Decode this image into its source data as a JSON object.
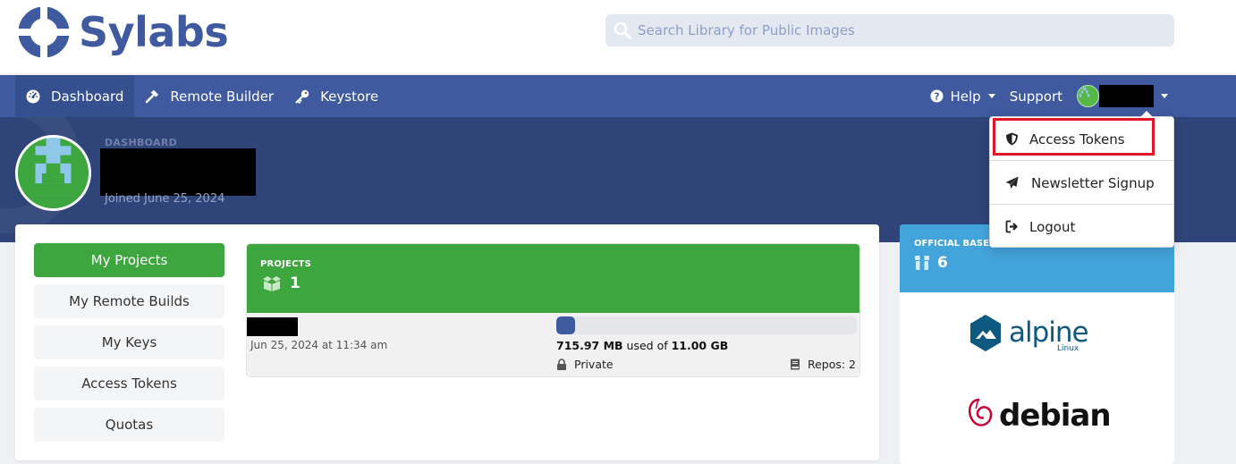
{
  "brand": {
    "name": "Sylabs",
    "color": "#3f5a9e"
  },
  "search": {
    "placeholder": "Search Library for Public Images"
  },
  "nav": {
    "items": [
      {
        "label": "Dashboard",
        "icon": "dashboard-icon",
        "active": true
      },
      {
        "label": "Remote Builder",
        "icon": "hammer-icon"
      },
      {
        "label": "Keystore",
        "icon": "key-icon"
      }
    ],
    "right": {
      "help": "Help",
      "support": "Support"
    }
  },
  "profile": {
    "section_label": "DASHBOARD",
    "joined": "Joined June 25, 2024"
  },
  "sidebar": {
    "items": [
      {
        "label": "My Projects",
        "active": true
      },
      {
        "label": "My Remote Builds"
      },
      {
        "label": "My Keys"
      },
      {
        "label": "Access Tokens"
      },
      {
        "label": "Quotas"
      }
    ]
  },
  "projects": {
    "label": "PROJECTS",
    "count": "1",
    "date": "Jun 25, 2024 at 11:34 am",
    "usage_used": "715.97 MB",
    "usage_middle": " used of ",
    "usage_total": "11.00 GB",
    "usage_fraction": 0.0636,
    "visibility": "Private",
    "repos": "Repos: 2"
  },
  "official": {
    "label": "OFFICIAL BASE I",
    "count": "6",
    "logos": [
      "alpine linux",
      "debian"
    ]
  },
  "dropdown": {
    "items": [
      {
        "label": "Access Tokens",
        "icon": "shield-icon",
        "highlighted": true
      },
      {
        "label": "Newsletter Signup",
        "icon": "paper-plane-icon"
      },
      {
        "label": "Logout",
        "icon": "logout-icon"
      }
    ]
  },
  "colors": {
    "nav": "#3f5a9e",
    "band": "#2f4478",
    "green": "#3da63e",
    "blue": "#43a3db",
    "highlight": "#e0162b"
  }
}
